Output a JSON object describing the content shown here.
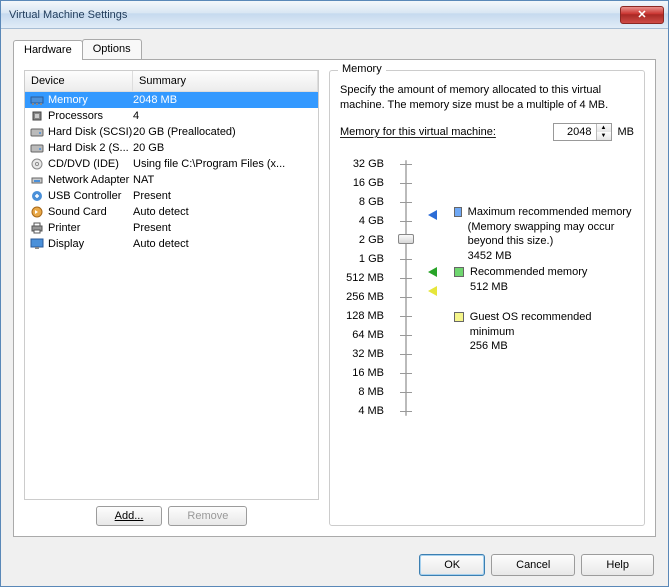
{
  "window": {
    "title": "Virtual Machine Settings"
  },
  "tabs": {
    "hardware": "Hardware",
    "options": "Options"
  },
  "device_table": {
    "col_device": "Device",
    "col_summary": "Summary",
    "rows": [
      {
        "icon": "memory-icon",
        "name": "Memory",
        "summary": "2048 MB",
        "selected": true
      },
      {
        "icon": "cpu-icon",
        "name": "Processors",
        "summary": "4"
      },
      {
        "icon": "hdd-icon",
        "name": "Hard Disk (SCSI)",
        "summary": "20 GB (Preallocated)"
      },
      {
        "icon": "hdd-icon",
        "name": "Hard Disk 2 (S...",
        "summary": "20 GB"
      },
      {
        "icon": "cd-icon",
        "name": "CD/DVD (IDE)",
        "summary": "Using file C:\\Program Files (x..."
      },
      {
        "icon": "net-icon",
        "name": "Network Adapter",
        "summary": "NAT"
      },
      {
        "icon": "usb-icon",
        "name": "USB Controller",
        "summary": "Present"
      },
      {
        "icon": "sound-icon",
        "name": "Sound Card",
        "summary": "Auto detect"
      },
      {
        "icon": "printer-icon",
        "name": "Printer",
        "summary": "Present"
      },
      {
        "icon": "display-icon",
        "name": "Display",
        "summary": "Auto detect"
      }
    ]
  },
  "add_remove": {
    "add": "Add...",
    "remove": "Remove"
  },
  "memory": {
    "title": "Memory",
    "desc": "Specify the amount of memory allocated to this virtual machine. The memory size must be a multiple of 4 MB.",
    "input_label": "Memory for this virtual machine:",
    "value": "2048",
    "unit": "MB",
    "ticks": [
      "32 GB",
      "16 GB",
      "8 GB",
      "4 GB",
      "2 GB",
      "1 GB",
      "512 MB",
      "256 MB",
      "128 MB",
      "64 MB",
      "32 MB",
      "16 MB",
      "8 MB",
      "4 MB"
    ],
    "legend": {
      "max": {
        "label": "Maximum recommended memory",
        "note": "(Memory swapping may occur beyond this size.)",
        "value": "3452 MB"
      },
      "rec": {
        "label": "Recommended memory",
        "value": "512 MB"
      },
      "min": {
        "label": "Guest OS recommended minimum",
        "value": "256 MB"
      }
    }
  },
  "buttons": {
    "ok": "OK",
    "cancel": "Cancel",
    "help": "Help"
  }
}
